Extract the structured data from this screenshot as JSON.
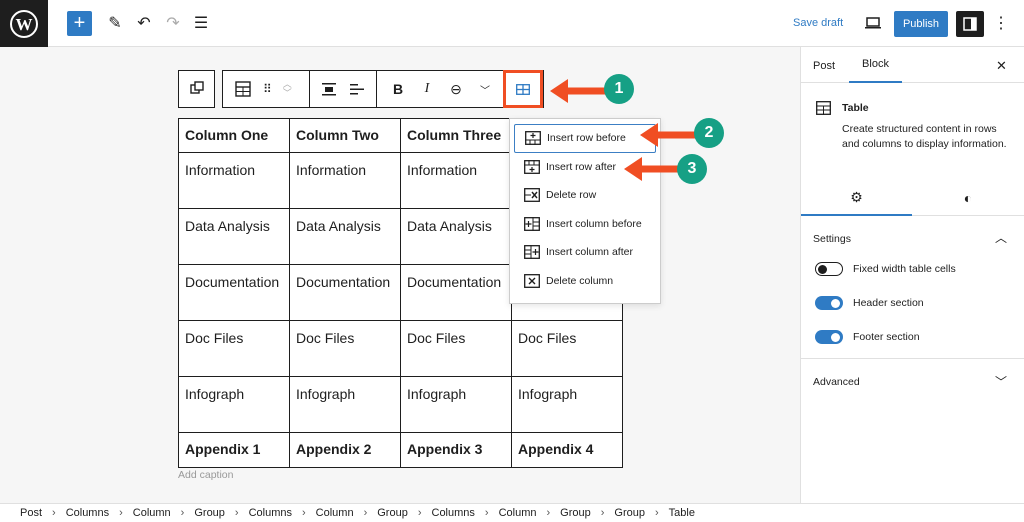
{
  "topbar": {
    "save_draft": "Save draft",
    "publish": "Publish"
  },
  "toolbar": {
    "icons": [
      "block-switch",
      "table",
      "drag",
      "move-up-down",
      "align",
      "justify",
      "bold",
      "italic",
      "link",
      "more",
      "edit-table"
    ]
  },
  "table": {
    "headers": [
      "Column One",
      "Column Two",
      "Column Three",
      ""
    ],
    "rows": [
      [
        "Information",
        "Information",
        "Information",
        ""
      ],
      [
        "Data Analysis",
        "Data Analysis",
        "Data Analysis",
        ""
      ],
      [
        "Documentation",
        "Documentation",
        "Documentation",
        ""
      ],
      [
        "Doc Files",
        "Doc Files",
        "Doc Files",
        "Doc Files"
      ],
      [
        "Infograph",
        "Infograph",
        "Infograph",
        "Infograph"
      ]
    ],
    "footer": [
      "Appendix 1",
      "Appendix 2",
      "Appendix 3",
      "Appendix 4"
    ],
    "caption_placeholder": "Add caption"
  },
  "menu": {
    "items": [
      "Insert row before",
      "Insert row after",
      "Delete row",
      "Insert column before",
      "Insert column after",
      "Delete column"
    ]
  },
  "annotations": {
    "b1": "1",
    "b2": "2",
    "b3": "3",
    "color": "#f04e23",
    "badge_color": "#16a085"
  },
  "sidebar": {
    "tabs": [
      "Post",
      "Block"
    ],
    "block_title": "Table",
    "block_desc": "Create structured content in rows and columns to display information.",
    "settings_title": "Settings",
    "toggles": [
      {
        "label": "Fixed width table cells",
        "on": false
      },
      {
        "label": "Header section",
        "on": true
      },
      {
        "label": "Footer section",
        "on": true
      }
    ],
    "advanced": "Advanced"
  },
  "breadcrumbs": [
    "Post",
    "Columns",
    "Column",
    "Group",
    "Columns",
    "Column",
    "Group",
    "Columns",
    "Column",
    "Group",
    "Group",
    "Table"
  ],
  "accent": "#3858e9"
}
